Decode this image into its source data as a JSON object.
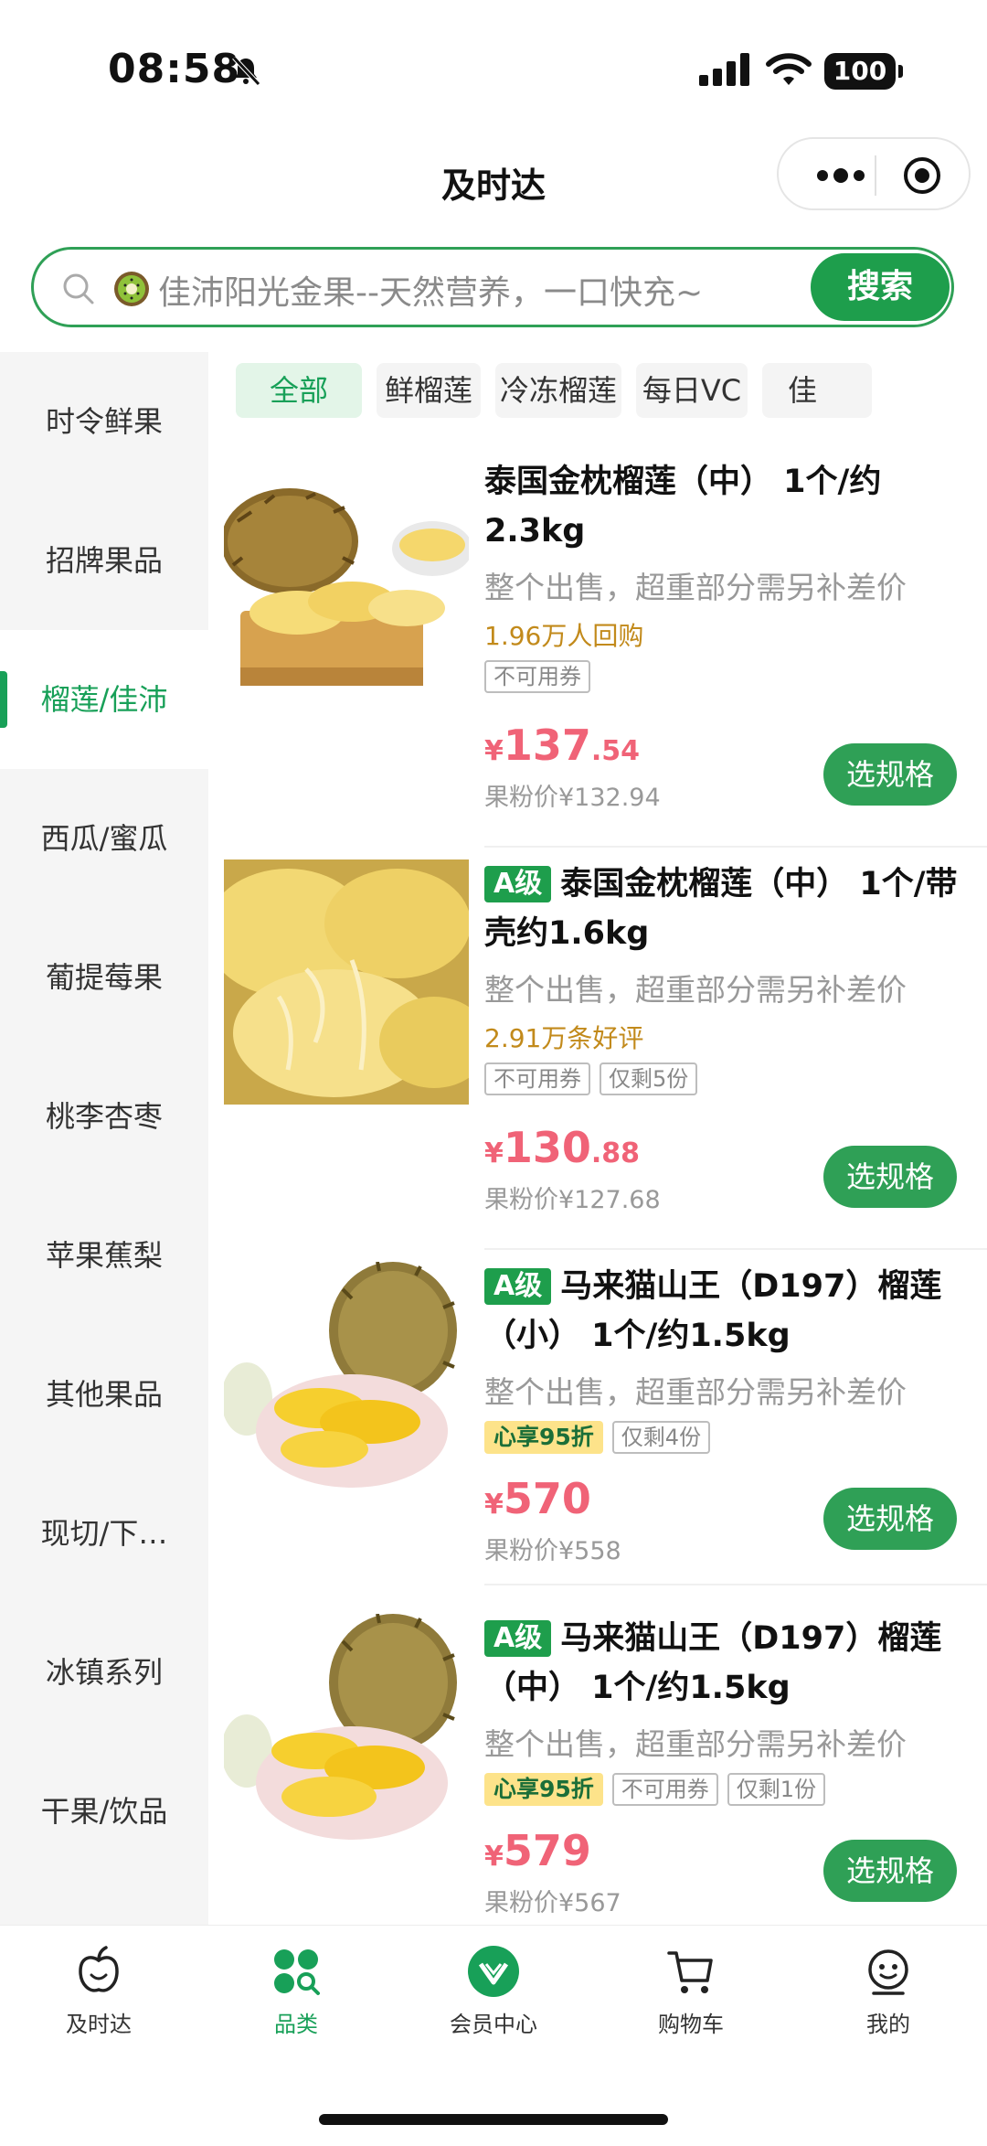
{
  "status": {
    "time": "08:58",
    "battery": "100"
  },
  "header": {
    "title": "及时达"
  },
  "search": {
    "placeholder": "佳沛阳光金果--天然营养，一口快充~",
    "button": "搜索"
  },
  "sidebar": {
    "items": [
      {
        "label": "时令鲜果"
      },
      {
        "label": "招牌果品"
      },
      {
        "label": "榴莲/佳沛"
      },
      {
        "label": "西瓜/蜜瓜"
      },
      {
        "label": "葡提莓果"
      },
      {
        "label": "桃李杏枣"
      },
      {
        "label": "苹果蕉梨"
      },
      {
        "label": "其他果品"
      },
      {
        "label": "现切/下…"
      },
      {
        "label": "冰镇系列"
      },
      {
        "label": "干果/饮品"
      }
    ],
    "active_index": 2
  },
  "tags": [
    {
      "label": "全部"
    },
    {
      "label": "鲜榴莲"
    },
    {
      "label": "冷冻榴莲"
    },
    {
      "label": "每日VC"
    },
    {
      "label": "佳"
    }
  ],
  "products": [
    {
      "grade": "",
      "name": "泰国金枕榴莲（中） 1个/约2.3kg",
      "desc": "整个出售，超重部分需另补差价",
      "sales": "1.96万人回购",
      "promo": "",
      "badges": [
        "不可用券"
      ],
      "price_symbol": "¥",
      "price_int": "137",
      "price_dec": ".54",
      "member_price": "果粉价¥132.94",
      "button": "选规格"
    },
    {
      "grade": "A级",
      "name": "泰国金枕榴莲（中） 1个/带壳约1.6kg",
      "desc": "整个出售，超重部分需另补差价",
      "sales": "2.91万条好评",
      "promo": "",
      "badges": [
        "不可用券",
        "仅剩5份"
      ],
      "price_symbol": "¥",
      "price_int": "130",
      "price_dec": ".88",
      "member_price": "果粉价¥127.68",
      "button": "选规格"
    },
    {
      "grade": "A级",
      "name": "马来猫山王（D197）榴莲（小） 1个/约1.5kg",
      "desc": "整个出售，超重部分需另补差价",
      "sales": "",
      "promo": "心享95折",
      "badges": [
        "仅剩4份"
      ],
      "price_symbol": "¥",
      "price_int": "570",
      "price_dec": "",
      "member_price": "果粉价¥558",
      "button": "选规格"
    },
    {
      "grade": "A级",
      "name": "马来猫山王（D197）榴莲（中） 1个/约1.5kg",
      "desc": "整个出售，超重部分需另补差价",
      "sales": "",
      "promo": "心享95折",
      "badges": [
        "不可用券",
        "仅剩1份"
      ],
      "price_symbol": "¥",
      "price_int": "579",
      "price_dec": "",
      "member_price": "果粉价¥567",
      "button": "选规格"
    }
  ],
  "tabbar": [
    {
      "label": "及时达",
      "icon": "apple-icon"
    },
    {
      "label": "品类",
      "icon": "category-icon"
    },
    {
      "label": "会员中心",
      "icon": "member-badge-icon"
    },
    {
      "label": "购物车",
      "icon": "cart-icon"
    },
    {
      "label": "我的",
      "icon": "profile-icon"
    }
  ],
  "colors": {
    "accent": "#1e9e4c",
    "price": "#f06377",
    "sales": "#c28a1b",
    "promo_bg": "#fde38a"
  }
}
